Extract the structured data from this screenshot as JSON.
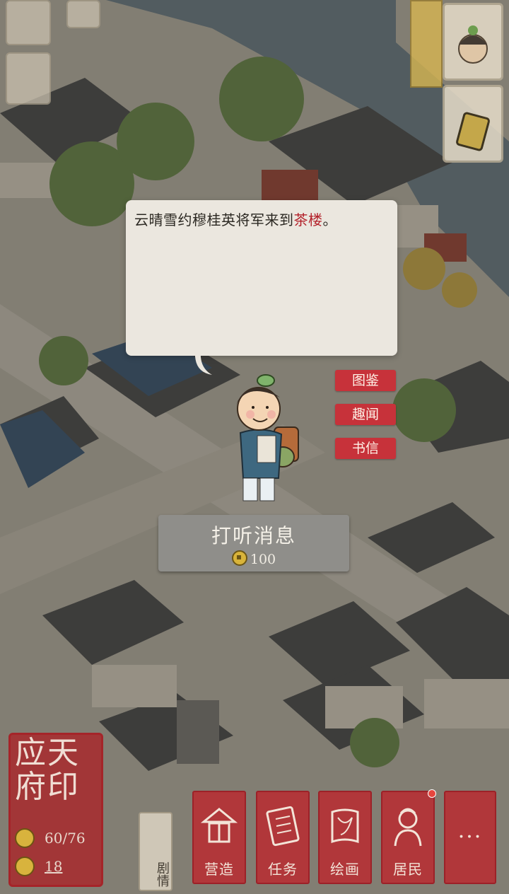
{
  "dialog": {
    "text_main": "云晴雪约穆桂英将军来到",
    "text_place": "茶楼",
    "text_end": "。"
  },
  "side_menu": [
    {
      "label": "图鉴"
    },
    {
      "label": "趣闻"
    },
    {
      "label": "书信"
    }
  ],
  "action": {
    "label": "打听消息",
    "cost": "100"
  },
  "seal": {
    "title_line1": "应天",
    "title_line2": "府印",
    "resource1": "60/76",
    "resource2": "18"
  },
  "toolbar": [
    {
      "label": "营造",
      "icon": "build-icon"
    },
    {
      "label": "任务",
      "icon": "task-icon"
    },
    {
      "label": "绘画",
      "icon": "painting-icon"
    },
    {
      "label": "居民",
      "icon": "residents-icon"
    }
  ],
  "more_label": "···",
  "small_portrait_label": "剧情",
  "colors": {
    "accent_red": "#c7323a",
    "dialog_bg": "#ebe7df",
    "place_text": "#b3222b"
  }
}
